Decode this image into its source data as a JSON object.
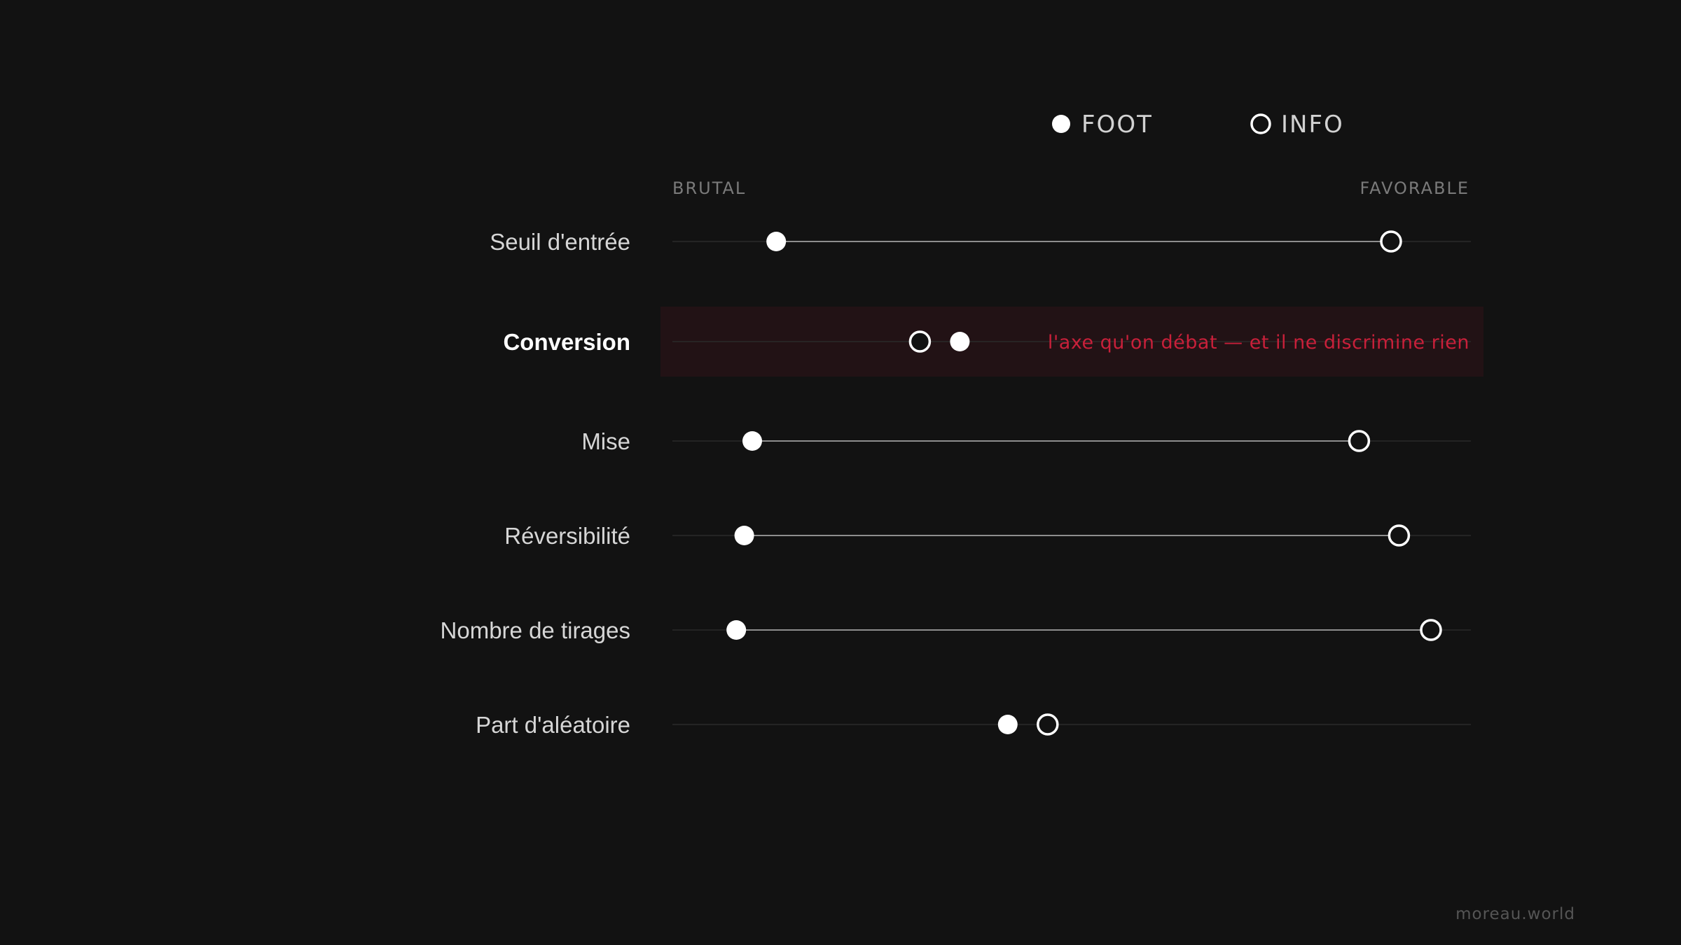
{
  "chart_data": {
    "type": "scatter",
    "subtype": "dumbbell",
    "title": "",
    "xlabel": "",
    "ylabel": "",
    "scale_labels": {
      "low": "BRUTAL",
      "high": "FAVORABLE"
    },
    "xlim": [
      0,
      100
    ],
    "grid": false,
    "legend_position": "top-right",
    "series": [
      {
        "name": "FOOT",
        "marker": "filled-circle"
      },
      {
        "name": "INFO",
        "marker": "hollow-circle"
      }
    ],
    "rows": [
      {
        "label": "Seuil d'entrée",
        "foot": 13,
        "info": 90,
        "connector": true,
        "highlight": false
      },
      {
        "label": "Conversion",
        "foot": 36,
        "info": 31,
        "connector": false,
        "highlight": true,
        "annotation": "l'axe qu'on débat — et il ne discrimine rien"
      },
      {
        "label": "Mise",
        "foot": 10,
        "info": 86,
        "connector": true,
        "highlight": false
      },
      {
        "label": "Réversibilité",
        "foot": 9,
        "info": 91,
        "connector": true,
        "highlight": false
      },
      {
        "label": "Nombre de tirages",
        "foot": 8,
        "info": 95,
        "connector": true,
        "highlight": false
      },
      {
        "label": "Part d'aléatoire",
        "foot": 42,
        "info": 47,
        "connector": false,
        "highlight": false
      }
    ]
  },
  "colors": {
    "background": "#121212",
    "marker": "#ffffff",
    "connector": "#8e8e8e",
    "track": "#2a2a2a",
    "highlight_band": "#221215",
    "accent": "#c8203a"
  },
  "credit": "moreau.world"
}
